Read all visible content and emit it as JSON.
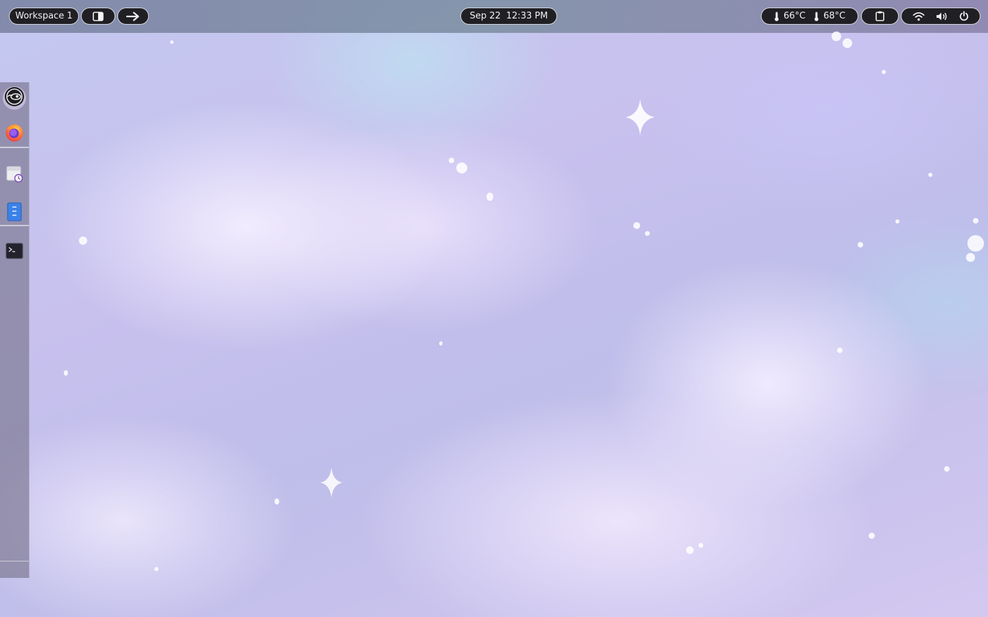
{
  "topbar": {
    "workspace_label": "Workspace 1",
    "clock": {
      "date": "Sep 22",
      "time": "12:33 PM"
    },
    "temperatures": [
      {
        "value": "66°C"
      },
      {
        "value": "68°C"
      }
    ],
    "icons": {
      "split": "split-view-icon",
      "next": "arrow-right-icon",
      "thermometer": "thermometer-icon",
      "clipboard": "clipboard-icon",
      "wifi": "wifi-icon",
      "volume": "volume-icon",
      "power": "power-icon"
    }
  },
  "dock": {
    "items": [
      {
        "app": "opensuse",
        "icon": "opensuse-icon"
      },
      {
        "app": "firefox",
        "icon": "firefox-icon"
      },
      {
        "app": "mail-scheduler",
        "icon": "mail-clock-icon"
      },
      {
        "app": "archive-manager",
        "icon": "archive-icon"
      },
      {
        "app": "terminal",
        "icon": "terminal-icon"
      }
    ]
  },
  "colors": {
    "pill_bg": "#202024",
    "pill_border": "#d8d8e0",
    "pill_text": "#f2f2f2",
    "wallpaper_lavender": "#c8c1ee",
    "wallpaper_cloud": "#f2ecff",
    "firefox_orange": "#ff7139",
    "archive_blue": "#3b82e8"
  }
}
